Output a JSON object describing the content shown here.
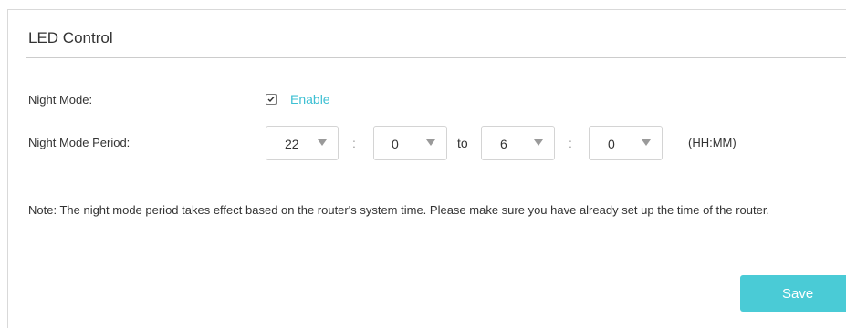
{
  "section": {
    "title": "LED Control"
  },
  "night_mode": {
    "label": "Night Mode:",
    "checkbox_checked": true,
    "enable_label": "Enable"
  },
  "night_mode_period": {
    "label": "Night Mode Period:",
    "start_hour": "22",
    "start_minute": "0",
    "end_hour": "6",
    "end_minute": "0",
    "separator": ":",
    "to_label": "to",
    "format_hint": "(HH:MM)"
  },
  "note": "Note: The night mode period takes effect based on the router's system time. Please make sure you have already set up the time of the router.",
  "actions": {
    "save_label": "Save"
  },
  "colors": {
    "accent": "#4acbd6",
    "link": "#3ec0d3"
  }
}
